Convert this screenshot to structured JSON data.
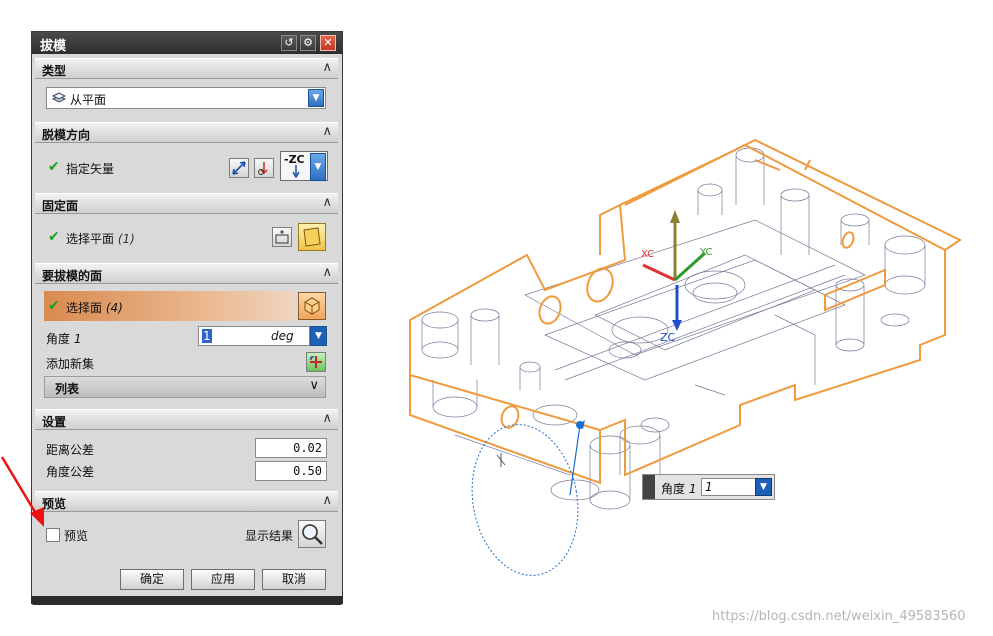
{
  "dialog": {
    "title": "拔模",
    "sections": {
      "type": {
        "label": "类型",
        "dropdown_value": "从平面"
      },
      "draw_direction": {
        "label": "脱模方向",
        "row_label": "指定矢量",
        "vector_value": "-ZC"
      },
      "fixed_face": {
        "label": "固定面",
        "row_label": "选择平面",
        "row_count": "(1)"
      },
      "faces": {
        "label": "要拔模的面",
        "row_label": "选择面",
        "row_count": "(4)",
        "angle_label": "角度",
        "angle_index": "1",
        "angle_value": "1",
        "angle_unit": "deg",
        "add_set_label": "添加新集",
        "list_label": "列表"
      },
      "settings": {
        "label": "设置",
        "distance_tol_label": "距离公差",
        "distance_tol_value": "0.02",
        "angle_tol_label": "角度公差",
        "angle_tol_value": "0.50"
      },
      "preview": {
        "label": "预览",
        "checkbox_label": "预览",
        "show_result_label": "显示结果",
        "checked": false
      }
    },
    "buttons": {
      "ok": "确定",
      "apply": "应用",
      "cancel": "取消"
    }
  },
  "viewport": {
    "axis_labels": {
      "xc": "XC",
      "yc": "YC",
      "zc": "ZC"
    },
    "angle_popup": {
      "label": "角度",
      "index": "1",
      "value": "1"
    },
    "colors": {
      "model_edge": "#f0a040",
      "wire": "#6f6f8f",
      "vector": "#1f6fd0",
      "z_axis": "#8a8030",
      "x_axis": "#d33",
      "y_axis": "#2a9a2a"
    }
  },
  "watermark": "https://blog.csdn.net/weixin_49583560"
}
